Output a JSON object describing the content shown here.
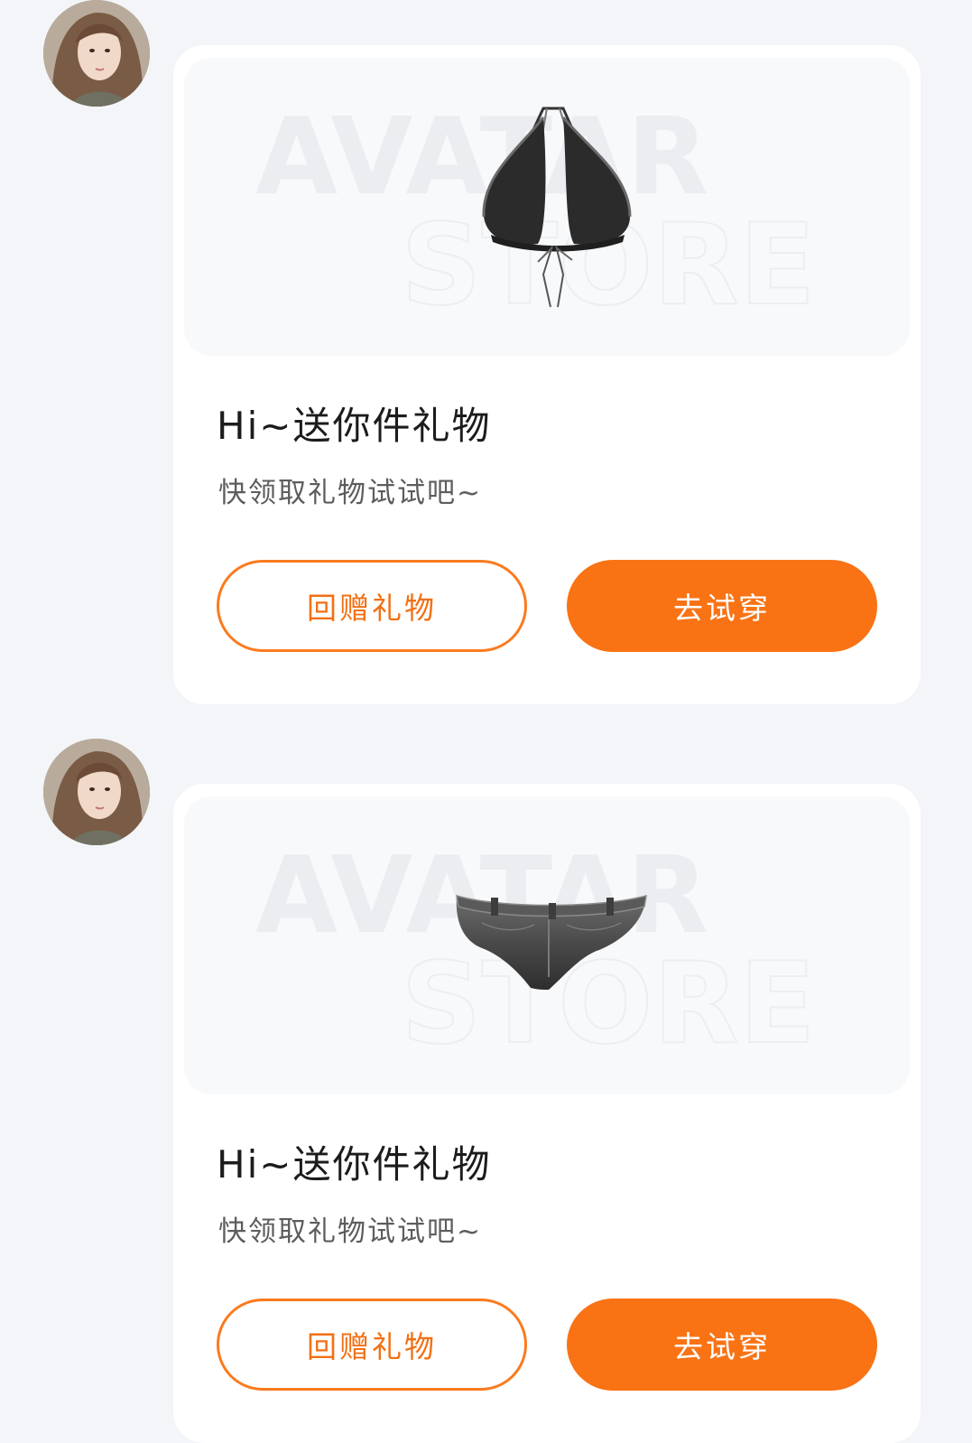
{
  "watermark": {
    "line1": "AVATAR",
    "line2": "STORE"
  },
  "messages": [
    {
      "item": "bikini-top",
      "title": "Hi~送你件礼物",
      "subtitle": "快领取礼物试试吧~",
      "return_gift_label": "回赠礼物",
      "try_on_label": "去试穿"
    },
    {
      "item": "denim-shorts",
      "title": "Hi~送你件礼物",
      "subtitle": "快领取礼物试试吧~",
      "return_gift_label": "回赠礼物",
      "try_on_label": "去试穿"
    }
  ],
  "colors": {
    "background": "#f3f5f8",
    "card": "#ffffff",
    "accent": "#f97315",
    "title": "#1c1c1c",
    "subtitle": "#5d5d5d"
  }
}
